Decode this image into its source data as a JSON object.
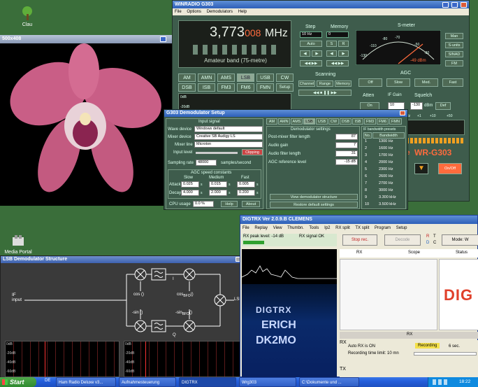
{
  "desktop": {
    "icons": [
      {
        "label": "Clau"
      },
      {
        "label": "Media Portal"
      }
    ]
  },
  "image_viewer": {
    "title": "500x408"
  },
  "g303": {
    "title": "WINRADIO G303",
    "menu": [
      "File",
      "Options",
      "Demodulators",
      "Help"
    ],
    "frequency_main": "3,773",
    "frequency_sub": "008",
    "frequency_unit": "MHz",
    "band": "Amateur band (75-metre)",
    "step": {
      "label": "Step",
      "value": "10 Hz",
      "auto": "Auto"
    },
    "memory": {
      "label": "Memory",
      "value": "0",
      "s": "S",
      "r": "R"
    },
    "smeter": {
      "label": "S-meter",
      "scale": [
        "-110",
        "-80",
        "-70",
        "-130",
        "-50",
        "-30"
      ],
      "reading": "-49 dBm",
      "buttons": [
        "Man",
        "S-units",
        "SINAD",
        "FM"
      ]
    },
    "modes": [
      "AM",
      "AMN",
      "AMS",
      "LSB",
      "USB",
      "CW",
      "DSB",
      "ISB",
      "FM3",
      "FM6",
      "FMN",
      "Setup"
    ],
    "scanning": {
      "label": "Scanning",
      "buttons": [
        "Channel",
        "Range",
        "Memory"
      ]
    },
    "agc": {
      "label": "AGC",
      "buttons": [
        "Off",
        "Slow",
        "Med.",
        "Fast"
      ]
    },
    "atten": {
      "label": "Atten",
      "button": "On"
    },
    "ifgain": {
      "label": "IF Gain",
      "value": "10"
    },
    "squelch": {
      "label": "Squelch",
      "value": "-130",
      "unit": "dBm",
      "button": "Def"
    },
    "scale_marks": [
      "Hz",
      "+1",
      "+10",
      "+50"
    ],
    "brand": "WR-G303",
    "brand_prefix": "e",
    "on_button": "On/Off",
    "level_axis": [
      "0dB",
      "-20dB"
    ]
  },
  "demod_setup": {
    "title": "G303 Demodulator Setup",
    "input_signal": "Input signal",
    "wave_device_label": "Wave device",
    "wave_device": "Windows default",
    "mixer_device_label": "Mixer device",
    "mixer_device": "Creative SB Audigy LS",
    "mixer_line_label": "Mixer line",
    "mixer_line": "Microton",
    "input_level_label": "Input level",
    "clipping": "Clipping",
    "sampling_label": "Sampling rate",
    "sampling_value": "48000",
    "sampling_unit": "samples/second",
    "agc_title": "AGC speed constants",
    "agc_cols": [
      "Slow",
      "Medium",
      "Fast"
    ],
    "attack_label": "Attack",
    "attack": [
      "0.025",
      "0.015",
      "0.005"
    ],
    "decay_label": "Decay",
    "decay": [
      "4.000",
      "2.000",
      "0.200"
    ],
    "unit_s": "s",
    "cpu_label": "CPU usage",
    "cpu_value": "0.0 %",
    "help": "Help",
    "about": "About",
    "tabs": [
      "AM",
      "AMN",
      "AMS",
      "LSB",
      "USB",
      "CW",
      "DSB",
      "ISB",
      "FM3",
      "FM6",
      "FMN"
    ],
    "demod_settings": "Demodulator settings",
    "post_mixer_label": "Post-mixer filter length",
    "post_mixer_value": "87",
    "audio_gain_label": "Audio gain",
    "audio_gain_value": "7",
    "audio_filter_label": "Audio filter length",
    "audio_filter_value": "31",
    "agc_ref_label": "AGC reference level",
    "agc_ref_value": "-15 dB",
    "view_structure": "View demodulator structure",
    "restore_defaults": "Restore default settings",
    "if_presets_title": "IF bandwidth presets",
    "if_cols": [
      "No.",
      "Bandwidth"
    ],
    "if_rows": [
      [
        "1",
        "1300 Hz"
      ],
      [
        "2",
        "1600 Hz"
      ],
      [
        "3",
        "1700 Hz"
      ],
      [
        "4",
        "2000 Hz"
      ],
      [
        "5",
        "2300 Hz"
      ],
      [
        "6",
        "2600 Hz"
      ],
      [
        "7",
        "2700 Hz"
      ],
      [
        "8",
        "3000 Hz"
      ],
      [
        "9",
        "3.300 kHz"
      ],
      [
        "10",
        "3.500 kHz"
      ]
    ]
  },
  "lsb_structure": {
    "title": "LSB Demodulator Structure",
    "if_input": "IF\ninput",
    "cos": "cos ()",
    "sin": "-sin ()",
    "cos_bfo": "cos",
    "bfo": "BFO",
    "sin_bfo": "-sin",
    "bfo_suffix": "()",
    "i": "I",
    "q": "Q",
    "lsb": "LSB",
    "scope_axis": [
      "0dB",
      "-20dB",
      "-40dB",
      "-60dB"
    ]
  },
  "digtrx": {
    "title": "DIGTRX  Ver 2.0.9.B   CLEMENS",
    "toolbar": [
      "File",
      "Replay",
      "View",
      "Thumbn.",
      "Tools",
      "Ip2",
      "RX split",
      "TX split",
      "Program",
      "Setup"
    ],
    "rx_peak": "RX peak level: -14 dB",
    "rx_signal": "RX signal OK",
    "stop_rec": "Stop rec.",
    "decode": "Decode",
    "rtdc": [
      "R",
      "T",
      "D",
      "C"
    ],
    "mode": "Mode: W",
    "cols": [
      "RX",
      "Scope",
      "Status"
    ],
    "waterfall_text": [
      "DIGTRX",
      "ERICH",
      "DK2MO"
    ],
    "rx_label": "RX",
    "logo": "DIG",
    "auto_rx": "Auto RX is ON",
    "recording": "Recording",
    "seconds": "6 sec.",
    "time_limit": "Recording time limit: 10 mn",
    "rx_side": "RX",
    "tx_side": "TX"
  },
  "taskbar": {
    "start": "Start",
    "lang": "DE",
    "tasks": [
      "Ham Radio Deluxe v3...",
      "Aufnahmesteuerung",
      "DIGTRX",
      "Wrg303",
      "C:\\Dokumente und ..."
    ],
    "clock": "18:22"
  },
  "colors": {
    "panel": "#3e5c4c",
    "accent": "#ff6b3d",
    "lcd": "#1b1f1a",
    "taskbar": "#245edb"
  }
}
